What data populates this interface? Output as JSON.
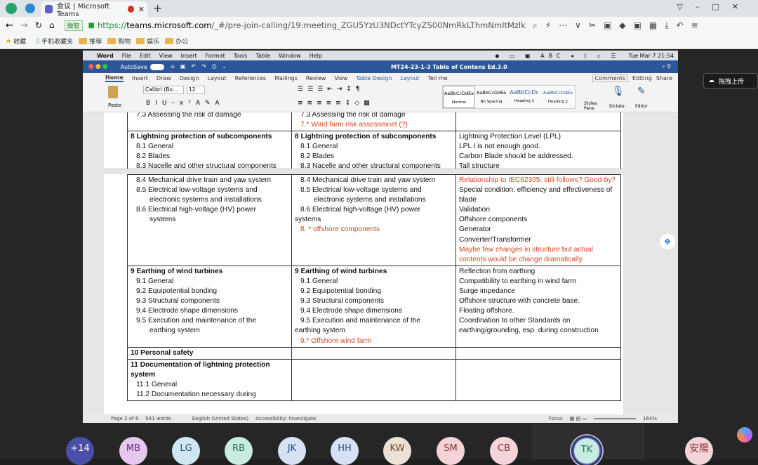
{
  "browser": {
    "tab_title": "会议 | Microsoft Teams",
    "url_prefix": "https://",
    "url_domain": "teams.microsoft.com",
    "url_path": "/_#/pre-join-calling/19:meeting_ZGU5YzU3NDctYTcyZS00NmRkLThmNmItMzlkMDg0YzI2ZGVm@threa",
    "wechat": "微软",
    "bookmarks": [
      "收藏",
      "手机收藏夹",
      "推荐",
      "购物",
      "娱乐",
      "办公"
    ]
  },
  "mac_menu": [
    "Word",
    "File",
    "Edit",
    "View",
    "Insert",
    "Format",
    "Tools",
    "Table",
    "Window",
    "Help"
  ],
  "clock": "Tue Mar 7  21:54",
  "doc_title": "MT24-23-1-3 Table of Contens Ed.3.0",
  "autosave": "AutoSave",
  "ribbon_tabs": [
    "Home",
    "Insert",
    "Draw",
    "Design",
    "Layout",
    "References",
    "Mailings",
    "Review",
    "View",
    "Table Design",
    "Layout",
    "Tell me"
  ],
  "ribbon_right": [
    "Comments",
    "Editing",
    "Share"
  ],
  "font_name": "Calibri (Bo...",
  "font_size": "12",
  "styles": [
    {
      "sample": "AaBbCcDdEe",
      "name": "Normal"
    },
    {
      "sample": "AaBbCcDdEe",
      "name": "No Spacing"
    },
    {
      "sample": "AaBbCcDc",
      "name": "Heading 1"
    },
    {
      "sample": "AaBbCcDdEe",
      "name": "Heading 2"
    }
  ],
  "ribbon_tools": [
    "Styles Pane",
    "Dictate",
    "Editor"
  ],
  "paste": "Paste",
  "table_top": {
    "c1": "7.3 Assessing the risk of damage",
    "c2a": "7.3 Assessing the risk of damage",
    "c2b": "7.* Wind farm risk assessmnet (?)"
  },
  "row8": {
    "c1": [
      "8 Lightning protection of subcomponents",
      "8.1 General",
      "8.2 Blades",
      "8.3 Nacelle and other structural components"
    ],
    "c2": [
      "8 Lightning protection of subcomponents",
      "8.1 General",
      "8.2 Blades",
      "8.3 Nacelle and other structural components"
    ],
    "c3": [
      "Lightning Protection Level (LPL)",
      "LPL I is not enough good.",
      "Carbon Blade should be addressed.",
      "Tall structure"
    ]
  },
  "row8b": {
    "c1": [
      "8.4 Mechanical drive train and yaw system",
      "8.5 Electrical low-voltage systems and",
      "electronic systems and installations",
      "8.6 Electrical high-voltage (HV) power",
      "systems"
    ],
    "c2": [
      "8.4 Mechanical drive train and yaw system",
      "8.5 Electrical low-voltage systems and",
      "electronic systems and installations",
      "8.6 Electrical high-voltage (HV) power",
      "systems",
      "8. * offshore components"
    ],
    "c3red1": "Relationship to IEC62305: still follows? Good-by?",
    "c3": [
      "Special condition: efficiency and effectiveness of blade",
      "Validation",
      "Offshore components",
      "Generator",
      "Converter/Transformer"
    ],
    "c3red2": "Maybe few changes in structure but actual contents would be change dramatically."
  },
  "row9": {
    "c1": [
      "9 Earthing of wind turbines",
      "9.1 General",
      "9.2 Equipotential bonding",
      "9.3 Structural components",
      "9.4 Electrode shape dimensions",
      "9.5 Execution and maintenance of the",
      "earthing system"
    ],
    "c2": [
      "9 Earthing of wind turbines",
      "9.1 General",
      "9.2 Equipotential bonding",
      "9.3 Structural components",
      "9.4 Electrode shape dimensions",
      "9.5 Execution and maintenance of the",
      "earthing system",
      "9.* Offshore wind farm"
    ],
    "c3": [
      "Reflection from earthing",
      "Compatibility to earthing in wind farm",
      "Surge impedance",
      "Offshore structure with concrete base.",
      "Floating offshore.",
      "Coordination to other Standards on",
      "earthing/grounding, esp. during construction"
    ]
  },
  "row10": "10 Personal safety",
  "row11": [
    "11 Documentation of lightning protection system",
    "11.1  General",
    "11.2  Documentation necessary during"
  ],
  "status": {
    "page": "Page 2 of 6",
    "words": "941 words",
    "lang": "English (United States)",
    "access": "Accessibility: Investigate",
    "focus": "Focus",
    "zoom": "164%"
  },
  "participants": [
    "+14",
    "MB",
    "LG",
    "RB",
    "JK",
    "HH",
    "KW",
    "SM",
    "CB",
    "TK",
    "安陽"
  ],
  "side_text": "拖拽上传"
}
